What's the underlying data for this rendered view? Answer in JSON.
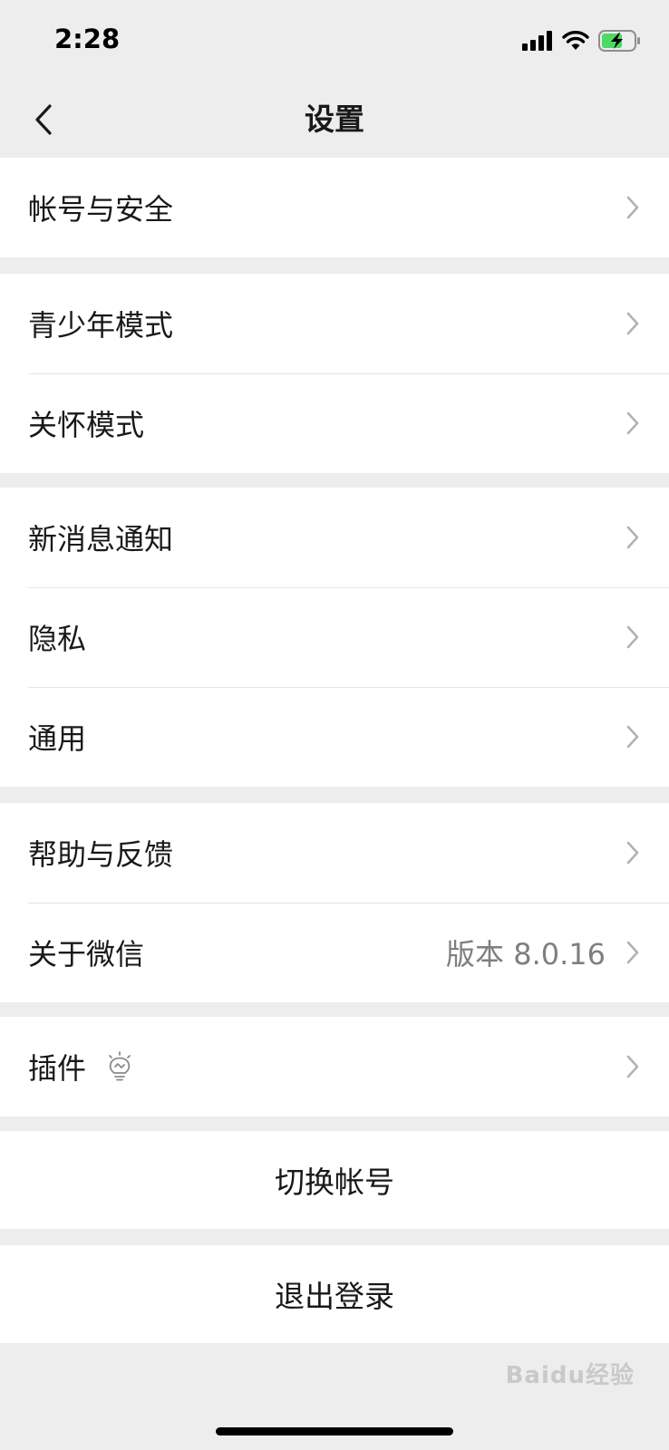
{
  "status_bar": {
    "time": "2:28",
    "icons": [
      "cellular-signal-icon",
      "wifi-icon",
      "battery-charging-icon"
    ]
  },
  "nav": {
    "title": "设置",
    "back_icon": "chevron-left-icon"
  },
  "groups": [
    {
      "items": [
        {
          "label": "帐号与安全"
        }
      ]
    },
    {
      "items": [
        {
          "label": "青少年模式"
        },
        {
          "label": "关怀模式"
        }
      ]
    },
    {
      "items": [
        {
          "label": "新消息通知"
        },
        {
          "label": "隐私"
        },
        {
          "label": "通用"
        }
      ]
    },
    {
      "items": [
        {
          "label": "帮助与反馈"
        },
        {
          "label": "关于微信",
          "value": "版本 8.0.16"
        }
      ]
    },
    {
      "items": [
        {
          "label": "插件",
          "icon": "lightbulb-icon"
        }
      ]
    }
  ],
  "actions": {
    "switch_account": "切换帐号",
    "logout": "退出登录"
  },
  "watermark": "Baidu经验",
  "colors": {
    "background": "#ededed",
    "cell": "#ffffff",
    "text": "#191919",
    "secondary_text": "#7f7f7f",
    "chevron": "#b2b2b2",
    "battery_fill": "#4cd964"
  }
}
